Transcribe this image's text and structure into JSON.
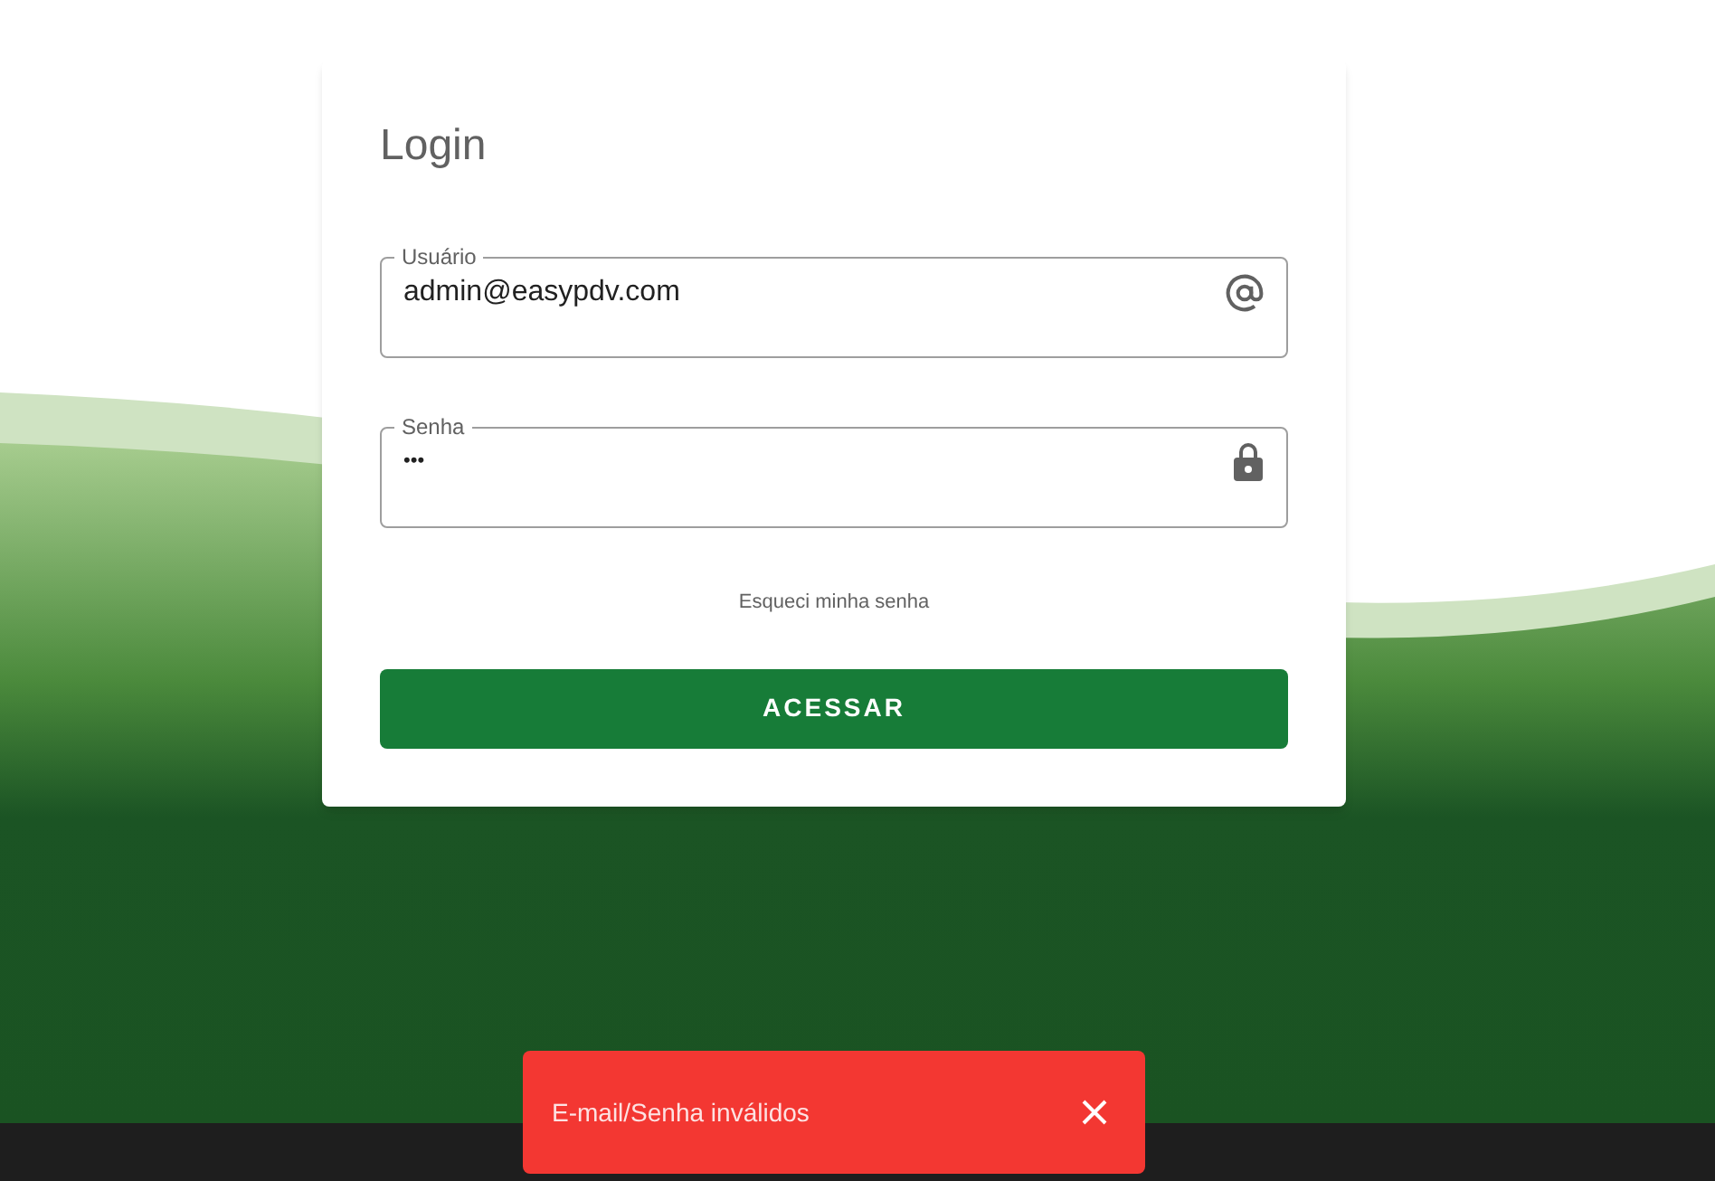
{
  "card": {
    "title": "Login"
  },
  "fields": [
    {
      "label": "Usuário",
      "value": "admin@easypdv.com",
      "kind": "email"
    },
    {
      "label": "Senha",
      "value": "•••",
      "kind": "password"
    }
  ],
  "forgot_link": "Esqueci minha senha",
  "submit_button": "ACESSAR",
  "toast": {
    "message": "E-mail/Senha inválidos"
  }
}
